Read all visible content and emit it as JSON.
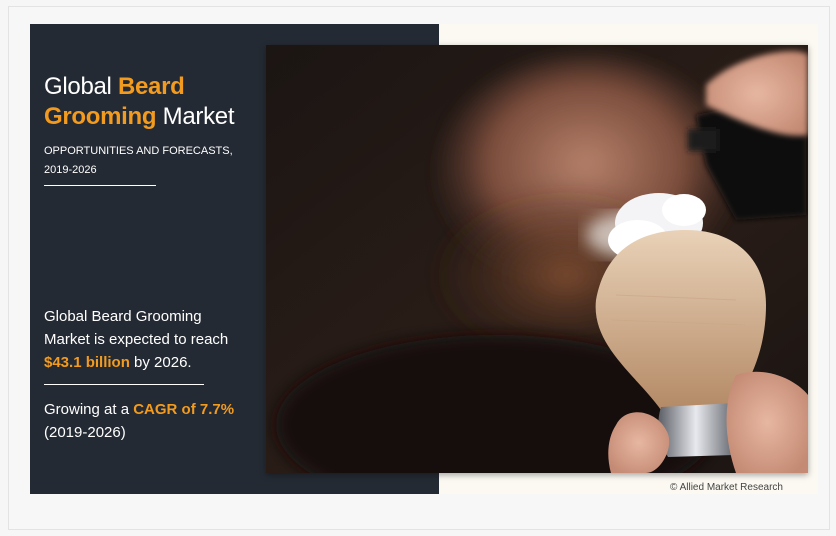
{
  "title": {
    "line1_plain": "Global ",
    "line1_highlight": "Beard",
    "line2_highlight": "Grooming",
    "line2_plain": " Market"
  },
  "subtitle": {
    "line1": "OPPORTUNITIES AND FORECASTS,",
    "line2": "2019-2026"
  },
  "statement": {
    "line1": "Global Beard Grooming",
    "line2": "Market is expected to reach",
    "value": "$43.1 billion",
    "suffix": " by 2026."
  },
  "growth": {
    "prefix": "Growing at a ",
    "cagr": "CAGR of 7.7%",
    "period": "(2019-2026)"
  },
  "credit": "© Allied Market Research",
  "colors": {
    "accent": "#f29b1f",
    "panel": "#242a33"
  }
}
